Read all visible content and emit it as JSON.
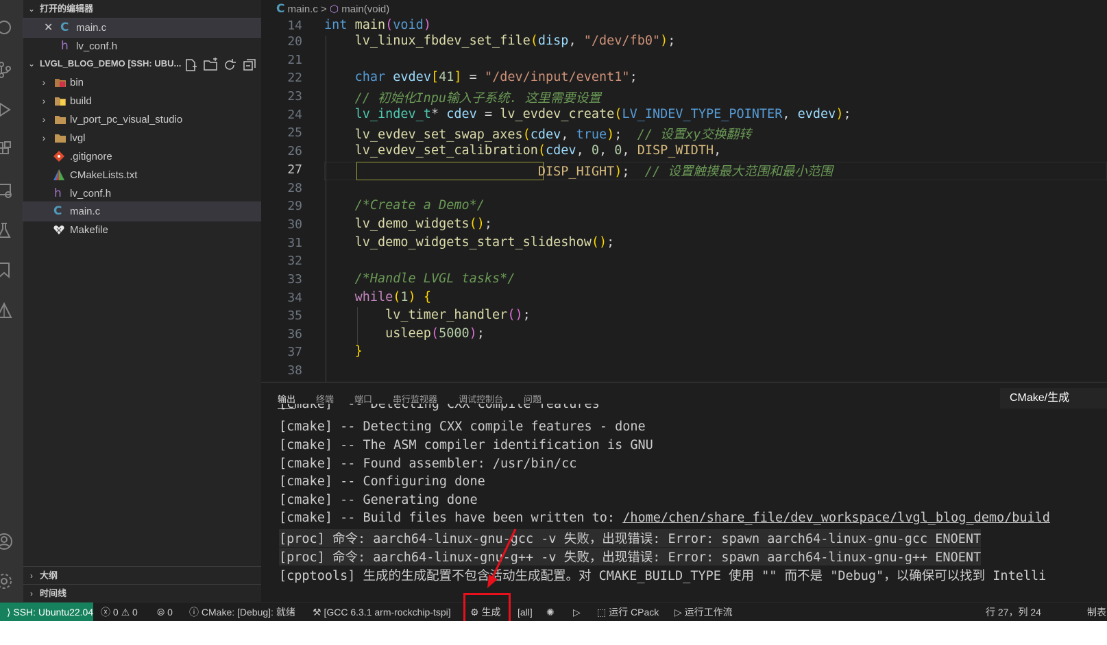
{
  "explorer": {
    "open_editors_title": "打开的编辑器",
    "open_editors": [
      {
        "name": "main.c",
        "icon": "c-file-icon"
      },
      {
        "name": "lv_conf.h",
        "icon": "h-file-icon"
      }
    ],
    "workspace_title": "LVGL_BLOG_DEMO [SSH: UBU...",
    "tree": [
      {
        "name": "bin",
        "type": "folder"
      },
      {
        "name": "build",
        "type": "folder"
      },
      {
        "name": "lv_port_pc_visual_studio",
        "type": "folder"
      },
      {
        "name": "lvgl",
        "type": "folder"
      },
      {
        "name": ".gitignore",
        "type": "file"
      },
      {
        "name": "CMakeLists.txt",
        "type": "file"
      },
      {
        "name": "lv_conf.h",
        "type": "file"
      },
      {
        "name": "main.c",
        "type": "file",
        "selected": true
      },
      {
        "name": "Makefile",
        "type": "file"
      }
    ],
    "outline_title": "大纲",
    "timeline_title": "时间线"
  },
  "breadcrumb": {
    "file": "main.c",
    "sep": ">",
    "symbol": "main(void)"
  },
  "editor": {
    "line_numbers": [
      "14",
      "20",
      "21",
      "22",
      "23",
      "24",
      "25",
      "26",
      "27",
      "28",
      "29",
      "30",
      "31",
      "32",
      "33",
      "34",
      "35",
      "36",
      "37",
      "38"
    ],
    "current_line": "27"
  },
  "panel": {
    "tabs": [
      "输出",
      "终端",
      "端口",
      "串行监视器",
      "调试控制台",
      "问题"
    ],
    "output_channel": "CMake/生成",
    "lines": [
      "[cmake]  -- Detecting CXX compile features",
      "[cmake] -- Detecting CXX compile features - done",
      "[cmake] -- The ASM compiler identification is GNU",
      "[cmake] -- Found assembler: /usr/bin/cc",
      "[cmake] -- Configuring done",
      "[cmake] -- Generating done",
      "[cmake] -- Build files have been written to: ",
      "[proc] 命令: aarch64-linux-gnu-gcc -v 失败，出现错误: Error: spawn aarch64-linux-gnu-gcc ENOENT",
      "[proc] 命令: aarch64-linux-gnu-g++ -v 失败，出现错误: Error: spawn aarch64-linux-gnu-g++ ENOENT",
      "[cpptools] 生成的生成配置不包含活动生成配置。对 CMAKE_BUILD_TYPE 使用 \"\" 而不是 \"Debug\"，以确保可以找到 Intelli"
    ],
    "build_path": "/home/chen/share_file/dev_workspace/lvgl_blog_demo/build"
  },
  "status": {
    "remote": "SSH: Ubuntu22.04",
    "errors": "0",
    "warnings": "0",
    "ports": "0",
    "cmake_status": "CMake: [Debug]: 就绪",
    "kit": "[GCC 6.3.1 arm-rockchip-tspi]",
    "build_label": "生成",
    "target": "[all]",
    "cpack": "运行 CPack",
    "workflow": "运行工作流",
    "cursor": "行 27，列 24",
    "trailing": "制表"
  }
}
